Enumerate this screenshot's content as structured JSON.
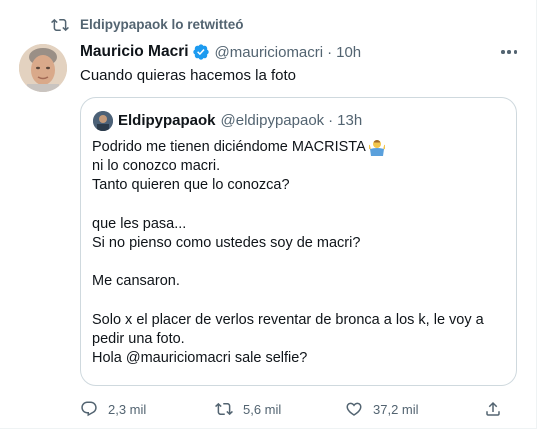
{
  "retweet": {
    "icon": "retweet-icon",
    "text": "Eldipypapaok lo retwitteó"
  },
  "tweet": {
    "author_name": "Mauricio Macri",
    "author_handle": "@mauriciomacri",
    "separator": "·",
    "time": "10h",
    "verified": true,
    "text": "Cuando quieras hacemos la foto"
  },
  "quote": {
    "author_name": "Eldipypapaok",
    "author_handle": "@eldipypapaok",
    "separator": "·",
    "time": "13h",
    "lines": [
      "Podrido me tienen diciéndome MACRISTA",
      "ni lo conozco macri.",
      "Tanto quieren que lo conozca?",
      "",
      "que les pasa...",
      "Si no pienso como ustedes soy de macri?",
      "",
      "Me cansaron.",
      "",
      "Solo x el placer de verlos reventar de bronca a los k, le voy a",
      "pedir una foto.",
      "Hola @mauriciomacri sale selfie?"
    ],
    "emoji": "man-shrugging-emoji"
  },
  "actions": {
    "replies": "2,3 mil",
    "retweets": "5,6 mil",
    "likes": "37,2 mil"
  },
  "colors": {
    "text": "#0f1419",
    "secondary": "#536471",
    "verified": "#1d9bf0",
    "border": "#cfd9de"
  }
}
